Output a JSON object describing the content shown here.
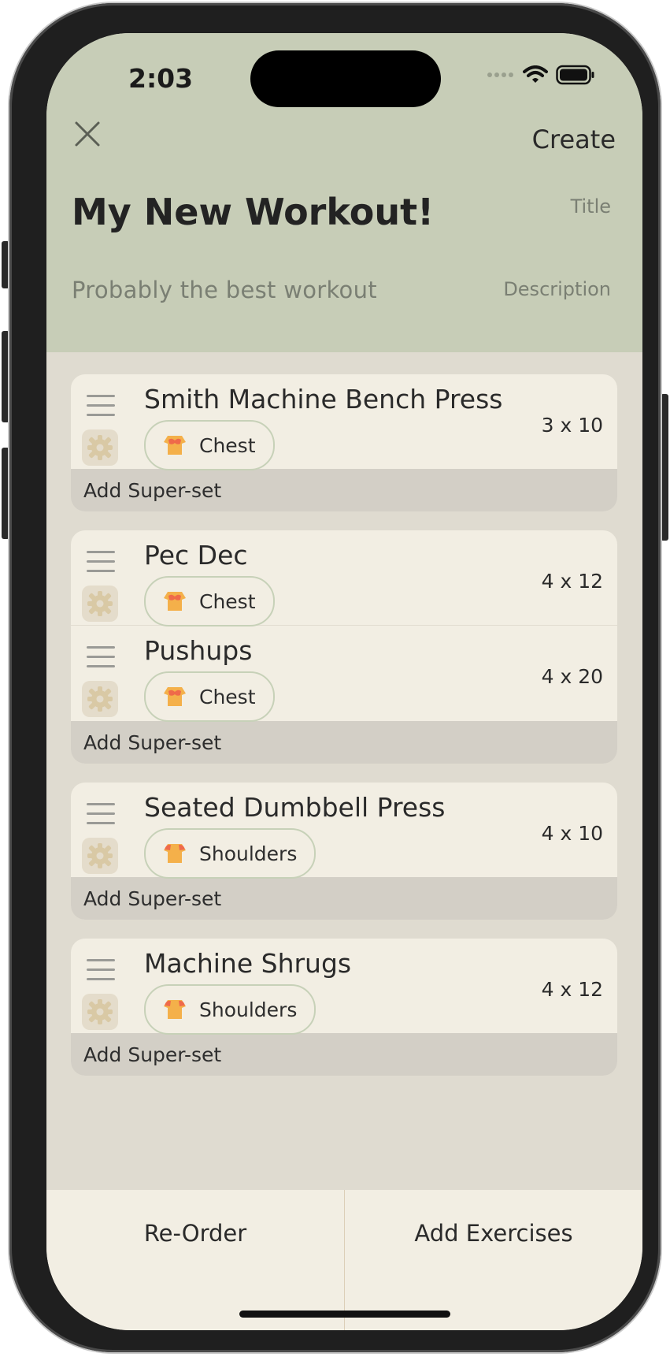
{
  "status_bar": {
    "time": "2:03"
  },
  "header": {
    "close_icon": "close-icon",
    "create_label": "Create",
    "title": "My New Workout!",
    "title_tag": "Title",
    "description": "Probably the best workout",
    "description_tag": "Description"
  },
  "groups": [
    {
      "exercises": [
        {
          "name": "Smith Machine Bench Press",
          "muscle": "Chest",
          "sets": "3 x 10"
        }
      ],
      "superset_label": "Add Super-set"
    },
    {
      "exercises": [
        {
          "name": "Pec Dec",
          "muscle": "Chest",
          "sets": "4 x 12"
        },
        {
          "name": "Pushups",
          "muscle": "Chest",
          "sets": "4 x 20"
        }
      ],
      "superset_label": "Add Super-set"
    },
    {
      "exercises": [
        {
          "name": "Seated Dumbbell Press",
          "muscle": "Shoulders",
          "sets": "4 x 10"
        }
      ],
      "superset_label": "Add Super-set"
    },
    {
      "exercises": [
        {
          "name": "Machine Shrugs",
          "muscle": "Shoulders",
          "sets": "4 x 12"
        }
      ],
      "superset_label": "Add Super-set"
    }
  ],
  "bottom_bar": {
    "reorder_label": "Re-Order",
    "add_label": "Add Exercises"
  },
  "colors": {
    "header_bg": "#c7cdb7",
    "card_bg": "#f2eee3",
    "superset_bg": "#d3cfc6",
    "chip_border": "#c7d1b8"
  }
}
